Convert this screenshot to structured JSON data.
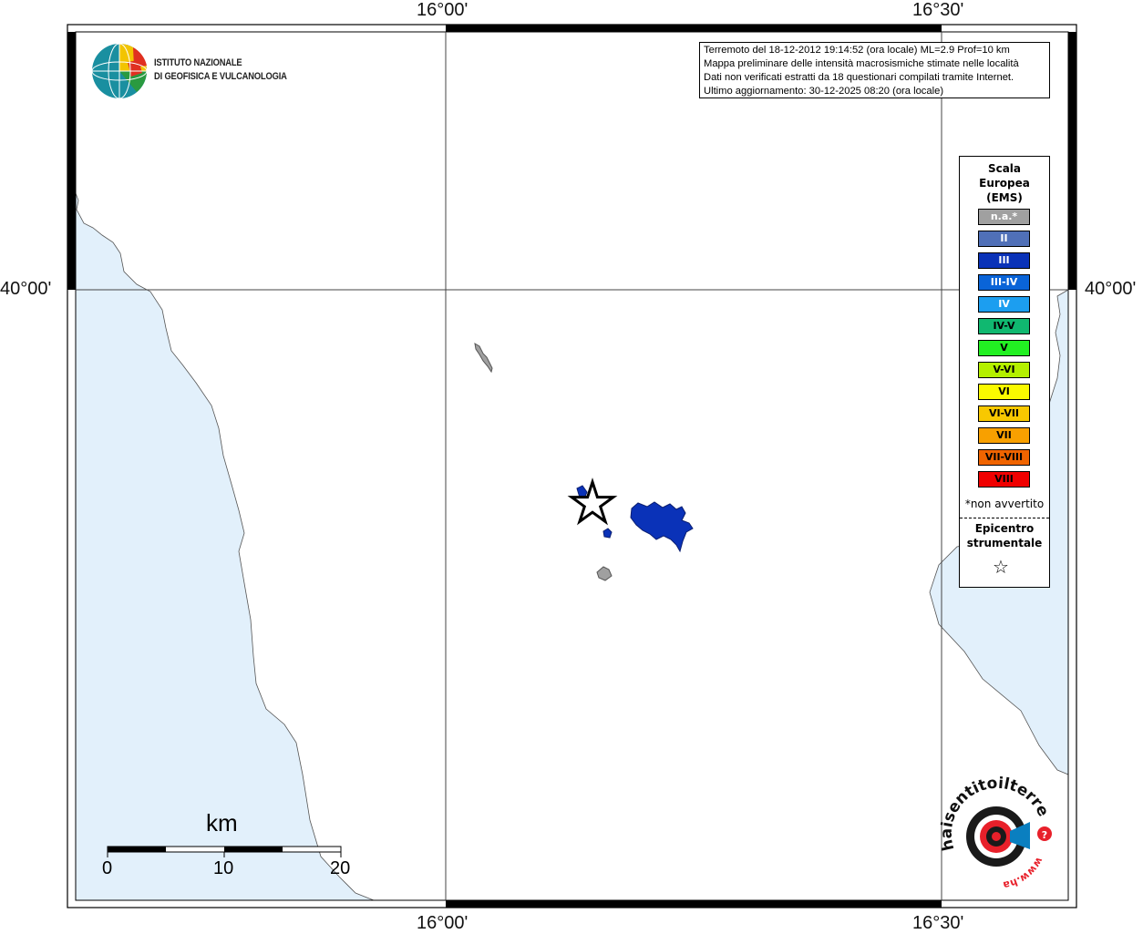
{
  "coords": {
    "lon_left": "16°00'",
    "lon_right": "16°30'",
    "lat": "40°00'"
  },
  "info": {
    "line1": "Terremoto del 18-12-2012 19:14:52 (ora locale) ML=2.9 Prof=10 km",
    "line2": "Mappa preliminare delle intensità macrosismiche stimate nelle località",
    "line3": "Dati non verificati estratti da 18 questionari compilati tramite Internet.",
    "line4": "Ultimo aggiornamento: 30-12-2025 08:20 (ora locale)"
  },
  "ingv": {
    "line1": "ISTITUTO NAZIONALE",
    "line2": "DI GEOFISICA E VULCANOLOGIA"
  },
  "legend": {
    "title1": "Scala",
    "title2": "Europea",
    "title3": "(EMS)",
    "items": [
      {
        "label": "n.a.*",
        "color": "#a0a0a0",
        "text": "#ffffff"
      },
      {
        "label": "II",
        "color": "#5070b8",
        "text": "#ffffff"
      },
      {
        "label": "III",
        "color": "#0a32b8",
        "text": "#ffffff"
      },
      {
        "label": "III-IV",
        "color": "#0a64d8",
        "text": "#ffffff"
      },
      {
        "label": "IV",
        "color": "#1c9ef0",
        "text": "#ffffff"
      },
      {
        "label": "IV-V",
        "color": "#10b870",
        "text": "#000000"
      },
      {
        "label": "V",
        "color": "#22f022",
        "text": "#000000"
      },
      {
        "label": "V-VI",
        "color": "#b4f000",
        "text": "#000000"
      },
      {
        "label": "VI",
        "color": "#fafa00",
        "text": "#000000"
      },
      {
        "label": "VI-VII",
        "color": "#f8c800",
        "text": "#000000"
      },
      {
        "label": "VII",
        "color": "#f8a000",
        "text": "#000000"
      },
      {
        "label": "VII-VIII",
        "color": "#f06400",
        "text": "#000000"
      },
      {
        "label": "VIII",
        "color": "#f00000",
        "text": "#000000"
      }
    ],
    "note": "*non avvertito",
    "epi1": "Epicentro",
    "epi2": "strumentale",
    "epi_symbol": "☆"
  },
  "scalebar": {
    "unit": "km",
    "ticks": [
      "0",
      "10",
      "20"
    ]
  },
  "colors": {
    "sea": "#e2f0fb",
    "intensity_iii": "#0a32b8",
    "not_felt": "#a0a0a0"
  },
  "haisentito": {
    "url": "www.haisentitoilterremoto.it"
  }
}
